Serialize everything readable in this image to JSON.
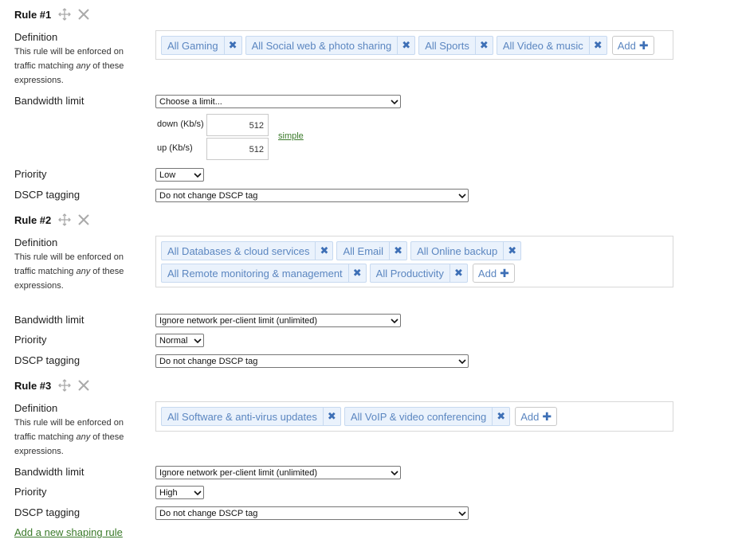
{
  "rules": [
    {
      "title": "Rule #1",
      "definition_label": "Definition",
      "definition_help_pre": "This rule will be enforced on traffic matching ",
      "definition_help_em": "any",
      "definition_help_post": " of these expressions.",
      "tags": [
        "All Gaming",
        "All Social web & photo sharing",
        "All Sports",
        "All Video & music"
      ],
      "add_label": "Add",
      "bandwidth_label": "Bandwidth limit",
      "bandwidth_value": "Choose a limit...",
      "down_label": "down (Kb/s)",
      "down_value": "512",
      "up_label": "up (Kb/s)",
      "up_value": "512",
      "simple_link": "simple",
      "priority_label": "Priority",
      "priority_value": "Low",
      "dscp_label": "DSCP tagging",
      "dscp_value": "Do not change DSCP tag"
    },
    {
      "title": "Rule #2",
      "definition_label": "Definition",
      "definition_help_pre": "This rule will be enforced on traffic matching ",
      "definition_help_em": "any",
      "definition_help_post": " of these expressions.",
      "tags_row1": [
        "All Databases & cloud services",
        "All Email",
        "All Online backup"
      ],
      "tags_row2": [
        "All Remote monitoring & management",
        "All Productivity"
      ],
      "add_label": "Add",
      "bandwidth_label": "Bandwidth limit",
      "bandwidth_value": "Ignore network per-client limit (unlimited)",
      "priority_label": "Priority",
      "priority_value": "Normal",
      "dscp_label": "DSCP tagging",
      "dscp_value": "Do not change DSCP tag"
    },
    {
      "title": "Rule #3",
      "definition_label": "Definition",
      "definition_help_pre": "This rule will be enforced on traffic matching ",
      "definition_help_em": "any",
      "definition_help_post": " of these expressions.",
      "tags": [
        "All Software & anti-virus updates",
        "All VoIP & video conferencing"
      ],
      "add_label": "Add",
      "bandwidth_label": "Bandwidth limit",
      "bandwidth_value": "Ignore network per-client limit (unlimited)",
      "priority_label": "Priority",
      "priority_value": "High",
      "dscp_label": "DSCP tagging",
      "dscp_value": "Do not change DSCP tag"
    }
  ],
  "add_rule_link": "Add a new shaping rule",
  "colors": {
    "tag_bg": "#eaf2fc",
    "tag_text": "#5b86c0",
    "tag_x": "#3d6fb6",
    "link_green": "#3a7a2a"
  },
  "icons": {
    "move": "move-arrows-icon",
    "close": "close-x-icon",
    "tag_remove": "remove-x-icon",
    "add": "plus-icon",
    "dropdown": "chevron-down-icon"
  }
}
